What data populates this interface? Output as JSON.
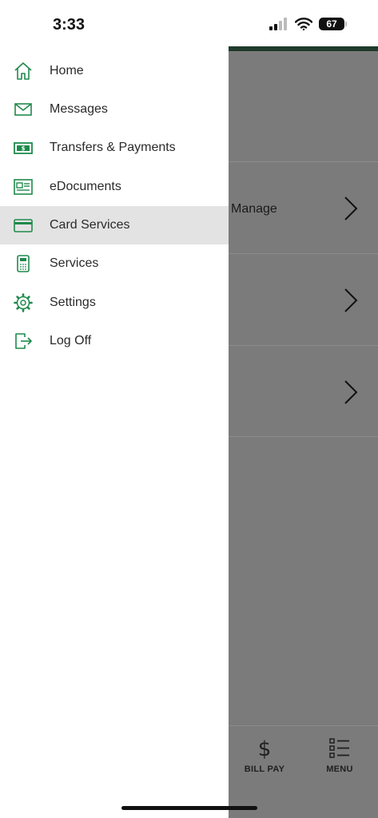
{
  "status_bar": {
    "time": "3:33",
    "battery": "67"
  },
  "menu": {
    "items": [
      {
        "label": "Home",
        "icon": "home-icon"
      },
      {
        "label": "Messages",
        "icon": "envelope-icon"
      },
      {
        "label": "Transfers & Payments",
        "icon": "money-icon"
      },
      {
        "label": "eDocuments",
        "icon": "document-icon"
      },
      {
        "label": "Card Services",
        "icon": "credit-card-icon",
        "active": true
      },
      {
        "label": "Services",
        "icon": "calculator-icon"
      },
      {
        "label": "Settings",
        "icon": "gear-icon"
      },
      {
        "label": "Log Off",
        "icon": "logout-icon"
      }
    ]
  },
  "background": {
    "rows": [
      {
        "label": "Manage"
      },
      {
        "label": ""
      },
      {
        "label": ""
      }
    ],
    "tabs": [
      {
        "label": "BILL PAY",
        "icon": "dollar-icon"
      },
      {
        "label": "MENU",
        "icon": "list-icon"
      }
    ]
  },
  "colors": {
    "accent": "#1f8a4c",
    "active_row": "#e3e3e3",
    "overlay": "#7c7b7b"
  }
}
